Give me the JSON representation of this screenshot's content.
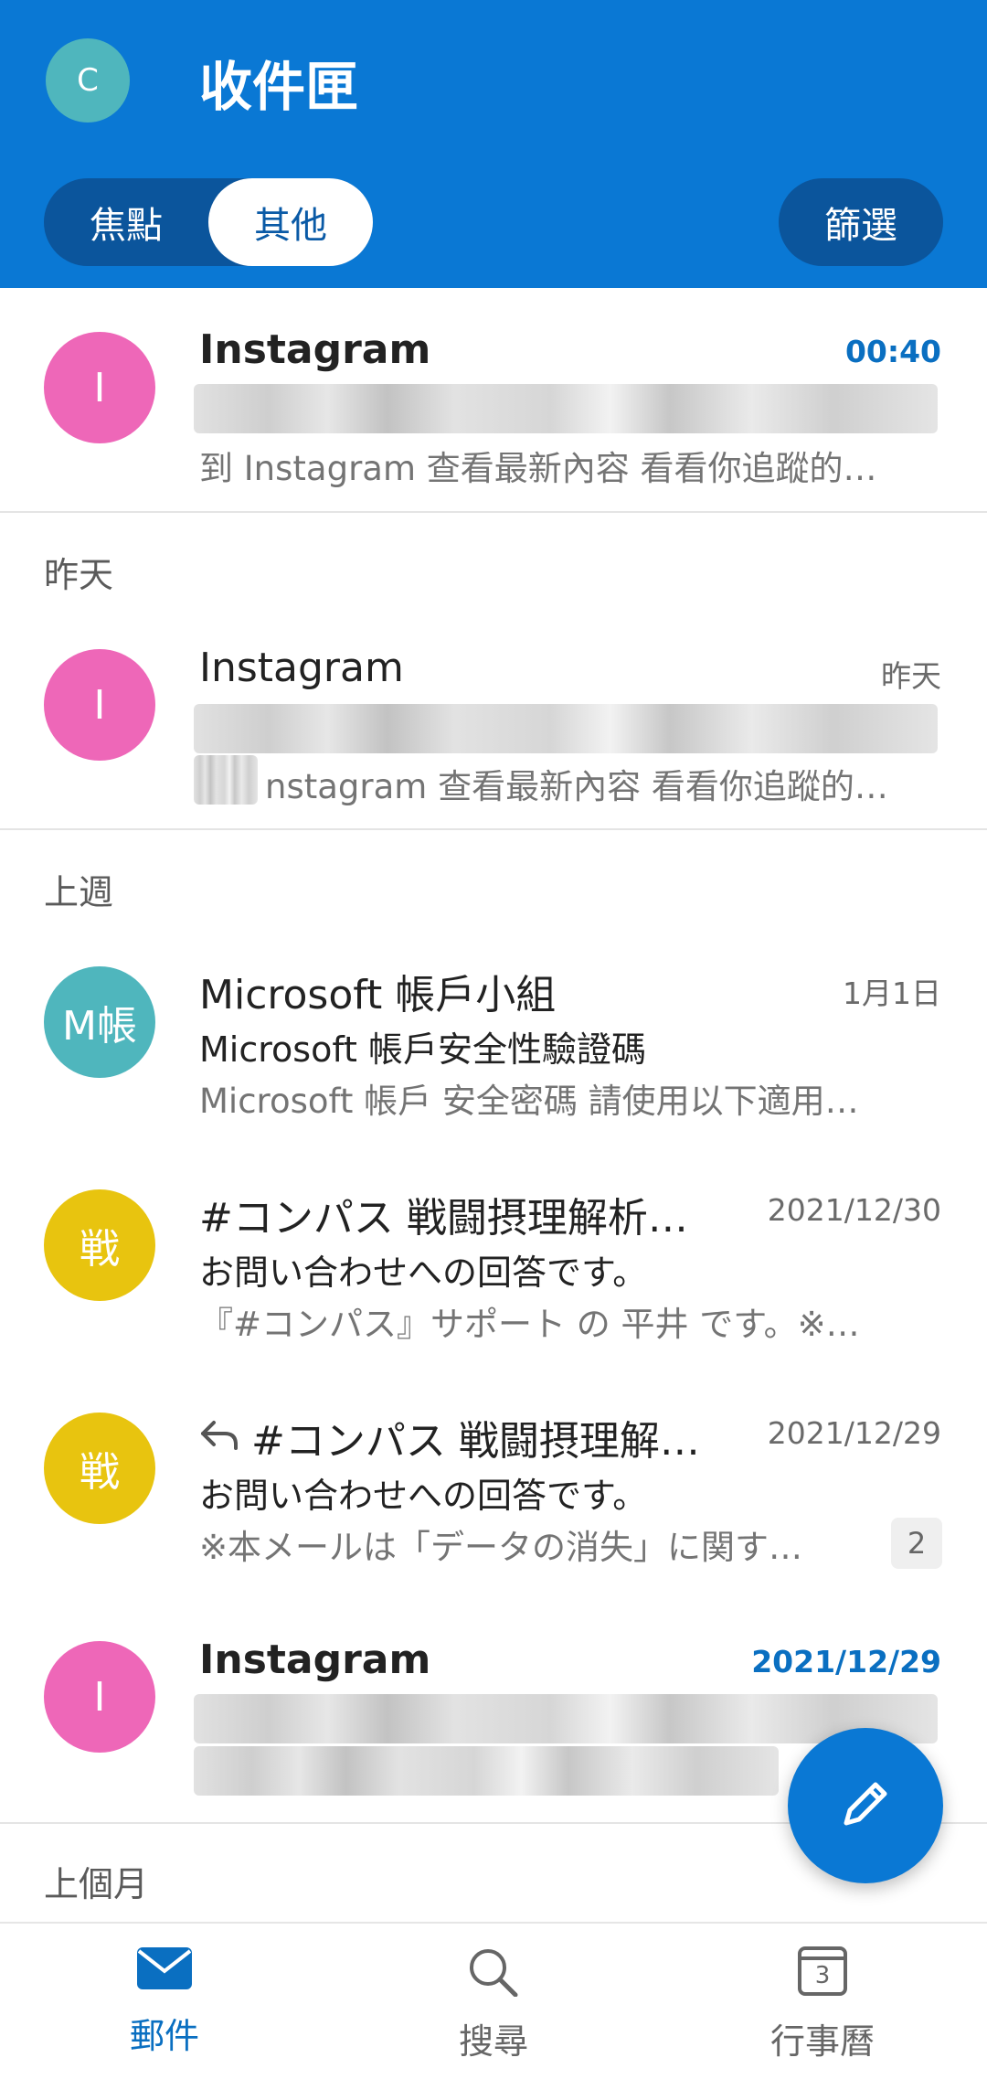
{
  "header": {
    "avatar_letter": "C",
    "title": "收件匣",
    "tabs": [
      "焦點",
      "其他"
    ],
    "filter_label": "篩選"
  },
  "sections": {
    "yesterday": "昨天",
    "last_week": "上週",
    "last_month": "上個月"
  },
  "emails": [
    {
      "avatar": "I",
      "sender": "Instagram",
      "date": "00:40",
      "preview": "到 Instagram 查看最新內容 看看你追蹤的…"
    },
    {
      "avatar": "I",
      "sender": "Instagram",
      "date": "昨天",
      "preview": "nstagram 查看最新內容 看看你追蹤的…"
    },
    {
      "avatar": "M帳",
      "sender": "Microsoft 帳戶小組",
      "date": "1月1日",
      "subject": "Microsoft 帳戶安全性驗證碼",
      "preview": "Microsoft 帳戶 安全密碼 請使用以下適用…"
    },
    {
      "avatar": "戦",
      "sender": "#コンパス 戦闘摂理解析…",
      "date": "2021/12/30",
      "subject": "お問い合わせへの回答です。",
      "preview": "『#コンパス』サポート の 平井 です。※…"
    },
    {
      "avatar": "戦",
      "sender": "#コンパス 戦闘摂理解…",
      "date": "2021/12/29",
      "subject": "お問い合わせへの回答です。",
      "preview": "※本メールは「データの消失」に関す…",
      "count": "2"
    },
    {
      "avatar": "I",
      "sender": "Instagram",
      "date": "2021/12/29"
    }
  ],
  "bottom_nav": [
    {
      "label": "郵件",
      "icon": "mail-icon"
    },
    {
      "label": "搜尋",
      "icon": "search-icon"
    },
    {
      "label": "行事曆",
      "icon": "calendar-icon",
      "calendar_day": "3"
    }
  ],
  "colors": {
    "brand": "#0a78d4",
    "avatar_pink": "#ee67b8",
    "avatar_teal": "#4fb6bd",
    "avatar_yellow": "#e8c40f"
  }
}
